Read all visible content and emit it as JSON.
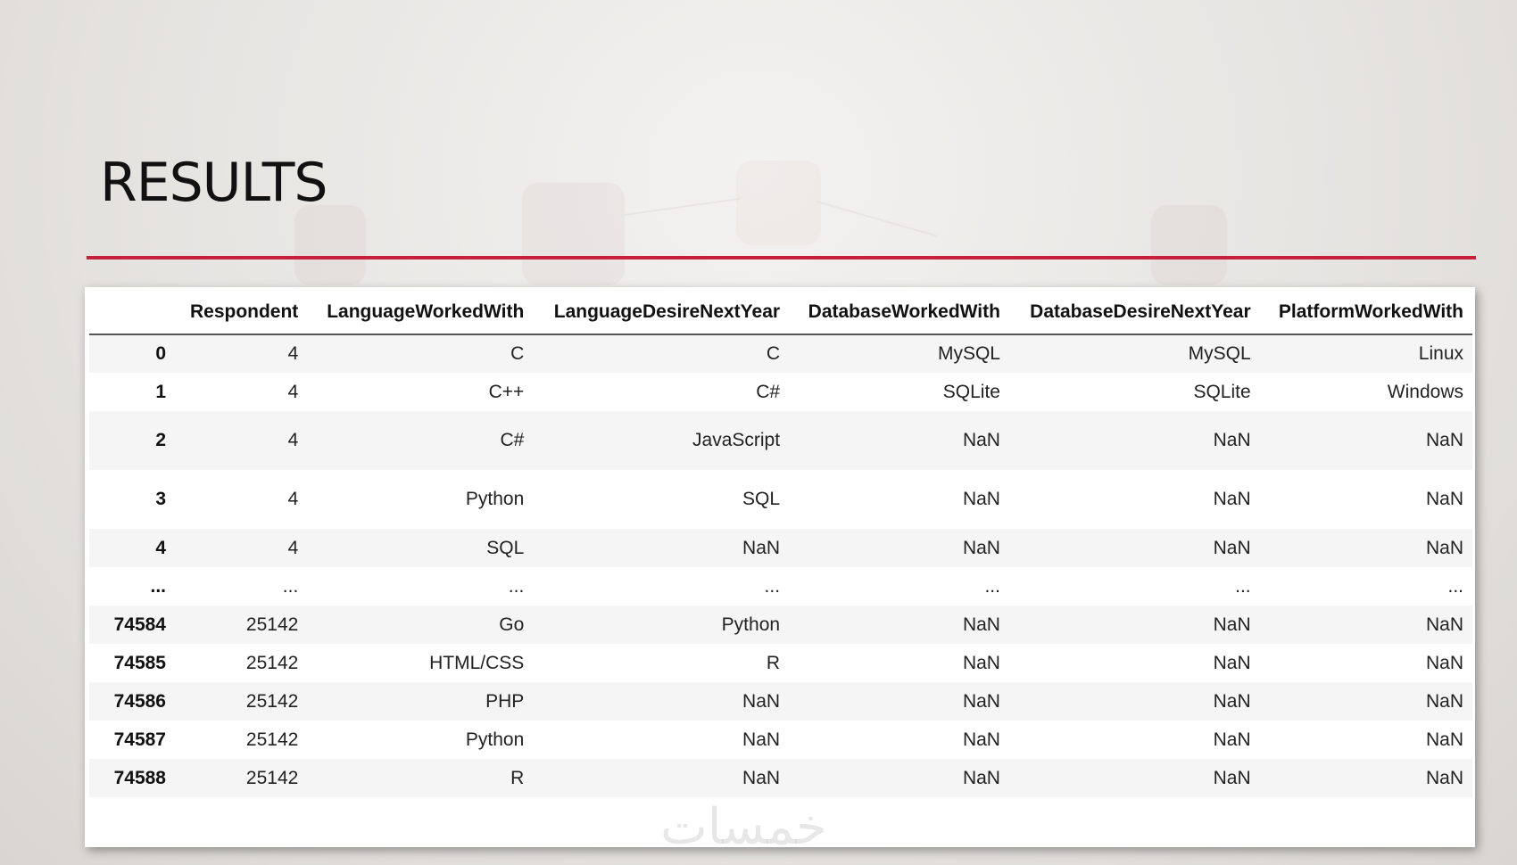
{
  "slide": {
    "title": "RESULTS",
    "accent_color": "#c8203a",
    "watermark": "خمسات"
  },
  "table": {
    "columns": [
      "",
      "Respondent",
      "LanguageWorkedWith",
      "LanguageDesireNextYear",
      "DatabaseWorkedWith",
      "DatabaseDesireNextYear",
      "PlatformWorkedWith"
    ],
    "rows": [
      {
        "index": "0",
        "cells": [
          "4",
          "C",
          "C",
          "MySQL",
          "MySQL",
          "Linux"
        ],
        "height": "normal"
      },
      {
        "index": "1",
        "cells": [
          "4",
          "C++",
          "C#",
          "SQLite",
          "SQLite",
          "Windows"
        ],
        "height": "normal"
      },
      {
        "index": "2",
        "cells": [
          "4",
          "C#",
          "JavaScript",
          "NaN",
          "NaN",
          "NaN"
        ],
        "height": "tall"
      },
      {
        "index": "3",
        "cells": [
          "4",
          "Python",
          "SQL",
          "NaN",
          "NaN",
          "NaN"
        ],
        "height": "tall"
      },
      {
        "index": "4",
        "cells": [
          "4",
          "SQL",
          "NaN",
          "NaN",
          "NaN",
          "NaN"
        ],
        "height": "normal"
      },
      {
        "index": "...",
        "cells": [
          "...",
          "...",
          "...",
          "...",
          "...",
          "..."
        ],
        "height": "normal"
      },
      {
        "index": "74584",
        "cells": [
          "25142",
          "Go",
          "Python",
          "NaN",
          "NaN",
          "NaN"
        ],
        "height": "normal"
      },
      {
        "index": "74585",
        "cells": [
          "25142",
          "HTML/CSS",
          "R",
          "NaN",
          "NaN",
          "NaN"
        ],
        "height": "normal"
      },
      {
        "index": "74586",
        "cells": [
          "25142",
          "PHP",
          "NaN",
          "NaN",
          "NaN",
          "NaN"
        ],
        "height": "normal"
      },
      {
        "index": "74587",
        "cells": [
          "25142",
          "Python",
          "NaN",
          "NaN",
          "NaN",
          "NaN"
        ],
        "height": "normal"
      },
      {
        "index": "74588",
        "cells": [
          "25142",
          "R",
          "NaN",
          "NaN",
          "NaN",
          "NaN"
        ],
        "height": "normal"
      }
    ]
  }
}
